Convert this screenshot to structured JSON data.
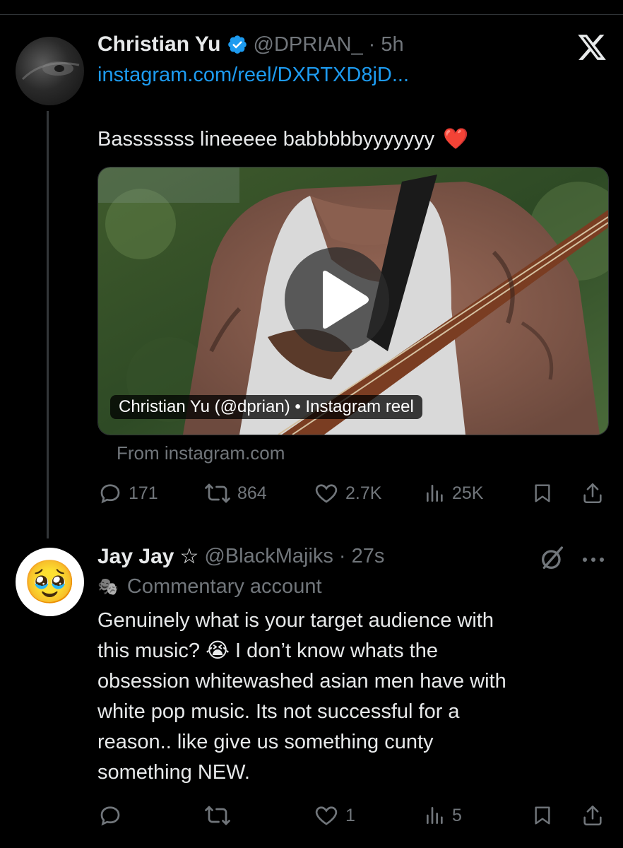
{
  "tweet1": {
    "author_name": "Christian Yu",
    "handle": "@DPRIAN_",
    "time": "· 5h",
    "link": "instagram.com/reel/DXRTXD8jD...",
    "text": "Basssssss lineeeee babbbbbyyyyyyy",
    "emoji": "❤️",
    "media_caption": "Christian Yu (@dprian) • Instagram reel",
    "media_source": "From instagram.com",
    "actions": {
      "replies": "171",
      "reposts": "864",
      "likes": "2.7K",
      "views": "25K"
    }
  },
  "tweet2": {
    "author_name": "Jay Jay",
    "name_symbol": "☆",
    "handle": "@BlackMajiks",
    "time": "· 27s",
    "label_icon": "🎭",
    "label": "Commentary account",
    "text_lines": [
      "Genuinely what is your target audience with",
      "this music? 😭 I don’t know whats the",
      "obsession whitewashed asian men have with",
      "white pop music. Its not successful for a",
      "reason.. like give us something cunty",
      "something NEW."
    ],
    "avatar_emoji": "🥹",
    "actions": {
      "replies": "",
      "reposts": "",
      "likes": "1",
      "views": "5"
    }
  },
  "colors": {
    "background": "#000000",
    "text": "#e7e9ea",
    "muted": "#71767b",
    "link": "#1d9bf0",
    "verified": "#1d9bf0"
  }
}
